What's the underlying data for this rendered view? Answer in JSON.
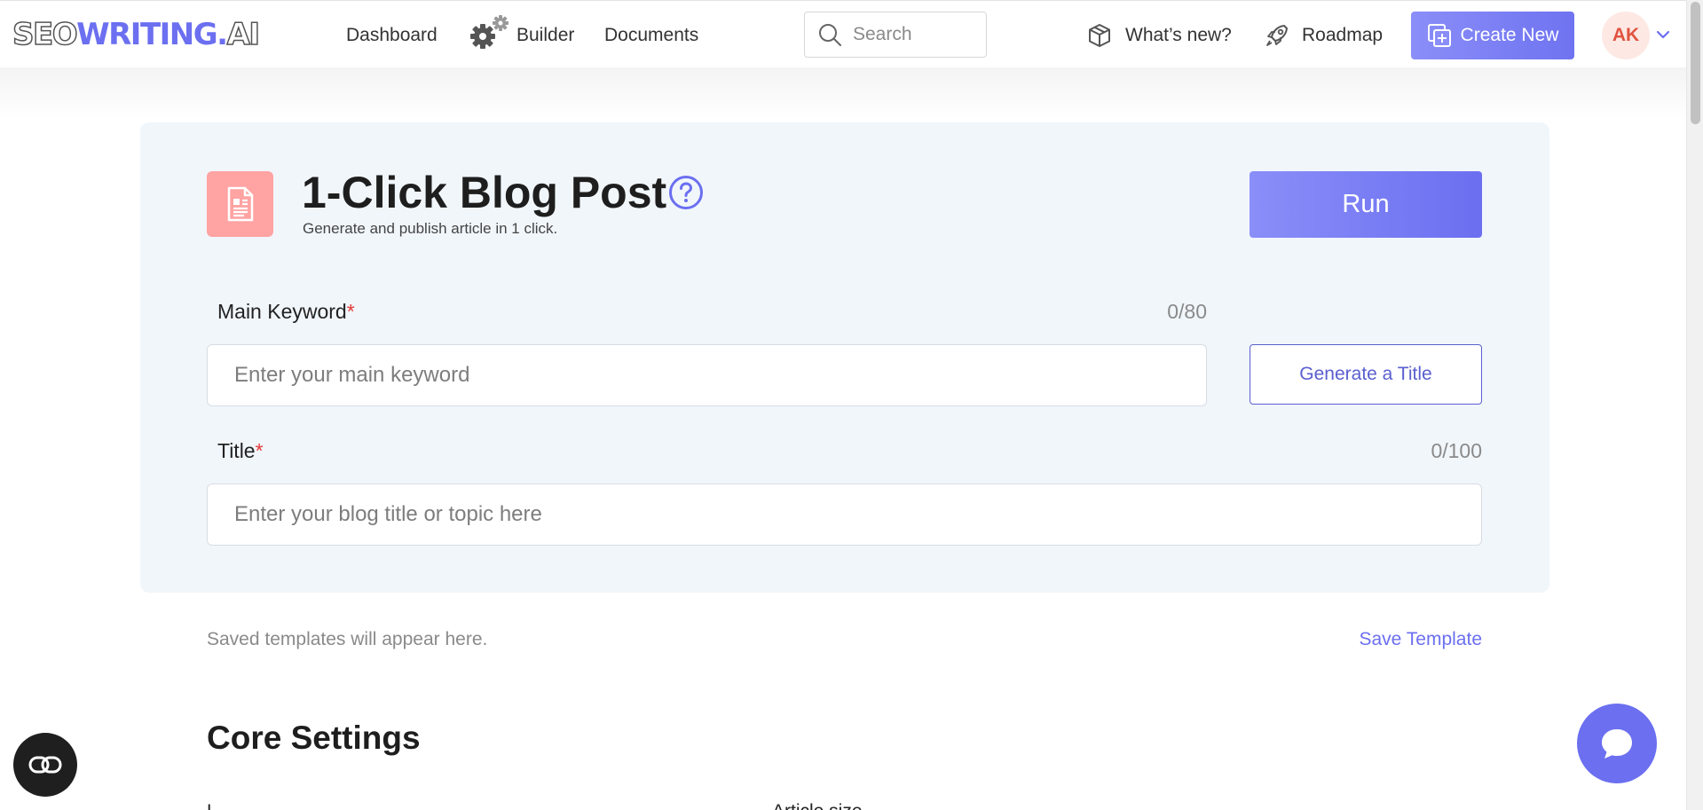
{
  "header": {
    "logo": {
      "part1": "SEO",
      "part2": "WRITING",
      "part3": ".",
      "part4": "AI"
    },
    "nav": {
      "dashboard": "Dashboard",
      "builder": "Builder",
      "documents": "Documents"
    },
    "search": {
      "placeholder": "Search",
      "value": ""
    },
    "whats_new": "What’s new?",
    "roadmap": "Roadmap",
    "create_new": "Create New",
    "avatar_initials": "AK"
  },
  "tool": {
    "title": "1-Click Blog Post",
    "subtitle": "Generate and publish article in 1 click.",
    "run_label": "Run",
    "fields": {
      "keyword": {
        "label": "Main Keyword",
        "required_mark": "*",
        "counter": "0/80",
        "placeholder": "Enter your main keyword",
        "value": ""
      },
      "title": {
        "label": "Title",
        "required_mark": "*",
        "counter": "0/100",
        "placeholder": "Enter your blog title or topic here",
        "value": ""
      }
    },
    "generate_title_label": "Generate a Title"
  },
  "templates": {
    "note": "Saved templates will appear here.",
    "save_label": "Save Template"
  },
  "core_settings": {
    "title": "Core Settings",
    "label_left": "L",
    "label_right": "Article size"
  },
  "colors": {
    "accent": "#6b6ff0",
    "badge": "#ffa3a3",
    "card_bg": "#f1f6fb",
    "required": "#e53935"
  }
}
